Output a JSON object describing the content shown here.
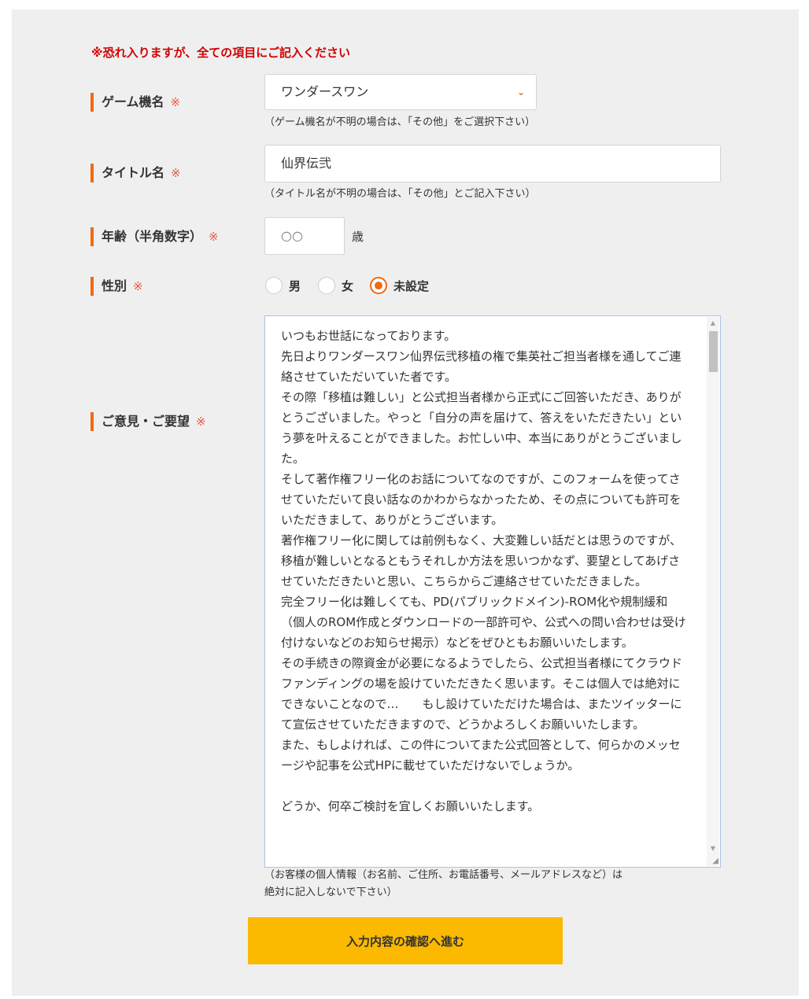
{
  "form": {
    "notice": "※恐れ入りますが、全ての項目にご記入ください",
    "required_mark": "※",
    "console": {
      "label": "ゲーム機名",
      "selected_value": "ワンダースワン",
      "note": "（ゲーム機名が不明の場合は、「その他」をご選択下さい）"
    },
    "title": {
      "label": "タイトル名",
      "value": "仙界伝弐",
      "note": "（タイトル名が不明の場合は、「その他」とご記入下さい）"
    },
    "age": {
      "label": "年齢（半角数字）",
      "placeholder": "○○",
      "unit": "歳"
    },
    "gender": {
      "label": "性別",
      "options": [
        {
          "label": "男",
          "checked": false
        },
        {
          "label": "女",
          "checked": false
        },
        {
          "label": "未設定",
          "checked": true
        }
      ]
    },
    "opinion": {
      "label": "ご意見・ご要望",
      "value": "いつもお世話になっております。\n先日よりワンダースワン仙界伝弐移植の権で集英社ご担当者様を通してご連絡させていただいていた者です。\nその際「移植は難しい」と公式担当者様から正式にご回答いただき、ありがとうございました。やっと「自分の声を届けて、答えをいただきたい」という夢を叶えることができました。お忙しい中、本当にありがとうございました。\nそして著作権フリー化のお話についてなのですが、このフォームを使ってさせていただいて良い話なのかわからなかったため、その点についても許可をいただきまして、ありがとうございます。\n著作権フリー化に関しては前例もなく、大変難しい話だとは思うのですが、移植が難しいとなるともうそれしか方法を思いつかなず、要望としてあげさせていただきたいと思い、こちらからご連絡させていただきました。\n完全フリー化は難しくても、PD(パブリックドメイン)-ROM化や規制緩和（個人のROM作成とダウンロードの一部許可や、公式への問い合わせは受け付けないなどのお知らせ掲示）などをぜひともお願いいたします。\nその手続きの際資金が必要になるようでしたら、公式担当者様にてクラウドファンディングの場を設けていただきたく思います。そこは個人では絶対にできないことなので…　　もし設けていただけた場合は、またツイッターにて宣伝させていただきますので、どうかよろしくお願いいたします。\nまた、もしよければ、この件についてまた公式回答として、何らかのメッセージや記事を公式HPに載せていただけないでしょうか。\n\nどうか、何卒ご検討を宜しくお願いいたします。"
    },
    "privacy_note_line1": "（お客様の個人情報（お名前、ご住所、お電話番号、メールアドレスなど）は",
    "privacy_note_line2": "絶対に記入しないで下さい）",
    "submit_label": "入力内容の確認へ進む"
  },
  "colors": {
    "accent": "#ef6b12",
    "notice_red": "#d10000",
    "button": "#fbb900",
    "panel_bg": "#efefef"
  },
  "icons": {
    "select_arrow": "chevron-down-icon",
    "scroll_up": "scroll-up-arrow-icon",
    "scroll_down": "scroll-down-arrow-icon",
    "resize": "resize-grip-icon"
  }
}
